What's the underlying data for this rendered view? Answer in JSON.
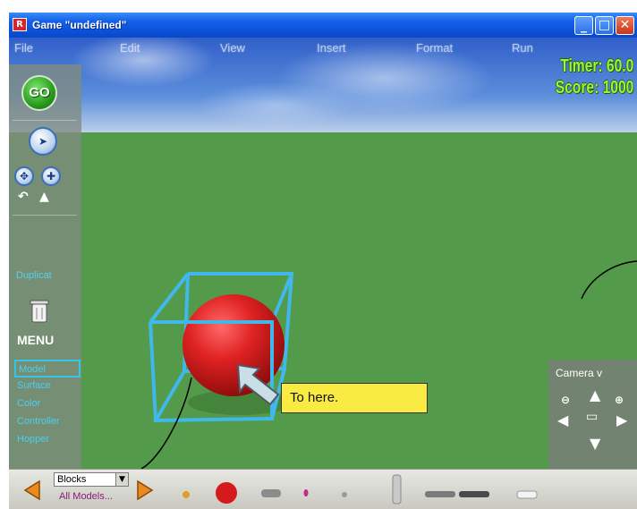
{
  "window": {
    "title": "Game \"undefined\"",
    "app_icon": "R"
  },
  "menubar": {
    "items": [
      "File",
      "Edit",
      "View",
      "Insert",
      "Format",
      "Run"
    ]
  },
  "hud": {
    "timer": "Timer: 60.0",
    "score": "Score: 1000"
  },
  "left_panel": {
    "go_label": "GO",
    "duplicate_label": "Duplicat",
    "menu_label": "MENU",
    "side_items": [
      "Model",
      "Surface",
      "Color",
      "Controller",
      "Hopper"
    ],
    "selected_item": "Model"
  },
  "scene": {
    "callout_text": "To here.",
    "sphere_color": "#d81f1f",
    "cube_color": "#41b8ec",
    "ground_color": "#549a4b"
  },
  "camera": {
    "title": "Camera  v"
  },
  "toolbar": {
    "category_value": "Blocks",
    "all_models_link": "All Models...",
    "palette_icons": [
      "small-sphere-icon",
      "red-sphere-icon",
      "gray-capsule-icon",
      "pink-gem-icon",
      "small-rock-icon",
      "pillar-icon",
      "flat-slab-icon",
      "dark-slab-icon",
      "white-bar-icon"
    ]
  }
}
